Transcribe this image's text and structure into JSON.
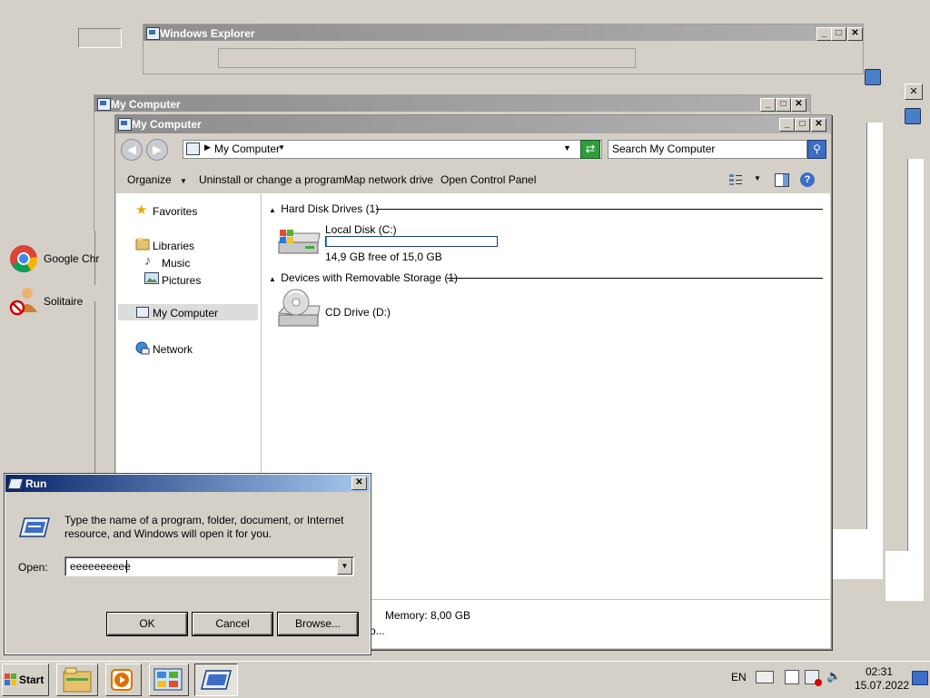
{
  "bg_windows": {
    "windows_explorer_title": "Windows Explorer",
    "my_computer_title": "My Computer"
  },
  "left_panel": {
    "items": [
      {
        "label": "Google Chr",
        "icon": "chrome-icon"
      },
      {
        "label": "Solitaire",
        "icon": "solitaire-icon"
      }
    ]
  },
  "explorer": {
    "title": "My Computer",
    "address": "My Computer",
    "search_placeholder": "Search My Computer",
    "toolbar": {
      "organize": "Organize",
      "uninstall": "Uninstall or change a program",
      "map_drive": "Map network drive",
      "control_panel": "Open Control Panel"
    },
    "nav": {
      "favorites": "Favorites",
      "libraries": "Libraries",
      "music": "Music",
      "pictures": "Pictures",
      "my_computer": "My Computer",
      "network": "Network"
    },
    "groups": {
      "hdd": "Hard Disk Drives (1)",
      "removable": "Devices with Removable Storage (1)"
    },
    "drives": {
      "local_disk": "Local Disk (C:)",
      "local_disk_free": "14,9 GB free of 15,0 GB",
      "local_disk_used_fraction": 0.007,
      "cd_drive": "CD Drive (D:)"
    },
    "details": {
      "memory": "Memory: 8,00 GB",
      "processor_partial": "o..."
    }
  },
  "run": {
    "title": "Run",
    "description": "Type the name of a program, folder, document, or Internet resource, and Windows will open it for you.",
    "open_label": "Open:",
    "open_value": "eeeeeeeeee",
    "ok": "OK",
    "cancel": "Cancel",
    "browse": "Browse..."
  },
  "taskbar": {
    "start": "Start",
    "lang": "EN",
    "time": "02:31",
    "date": "15.07.2022"
  },
  "colors": {
    "run_title_start": "#0a246a",
    "run_title_end": "#a6caf0",
    "explorer_title": "#8d8d8d",
    "selected_nav": "#dcdcdc"
  }
}
